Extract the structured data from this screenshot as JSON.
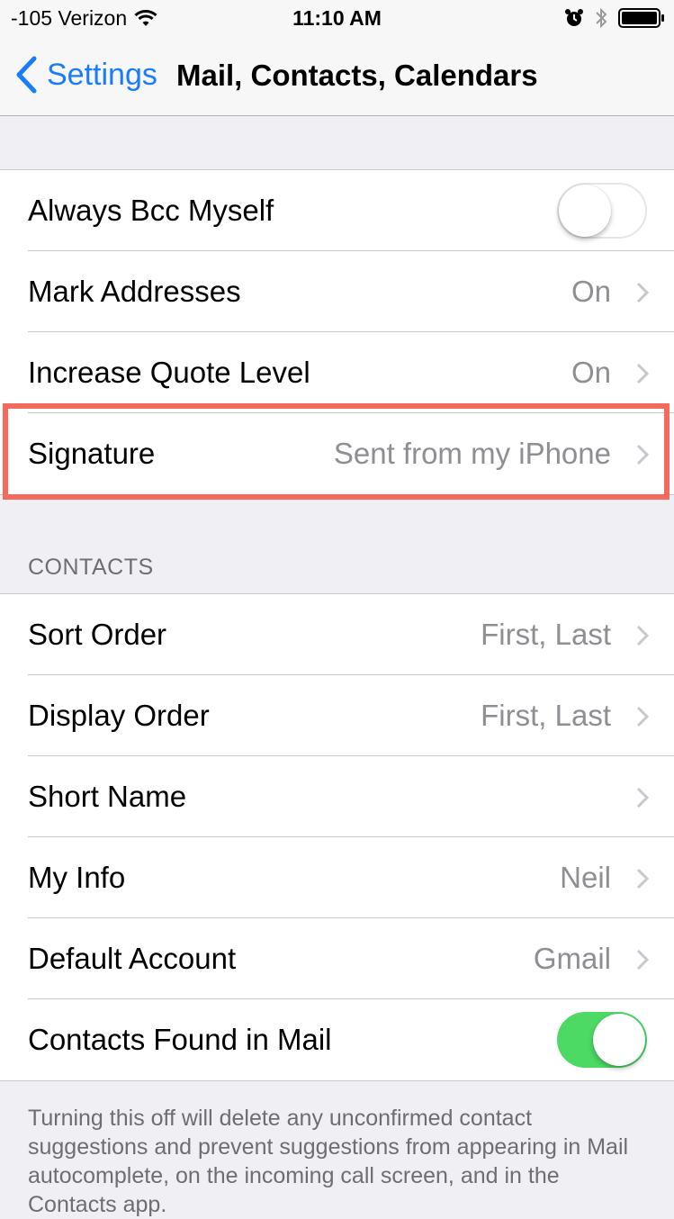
{
  "status_bar": {
    "carrier": "-105 Verizon",
    "time": "11:10 AM"
  },
  "nav": {
    "back_label": "Settings",
    "title": "Mail, Contacts, Calendars"
  },
  "mail_group": [
    {
      "label": "Always Bcc Myself",
      "type": "toggle",
      "on": false
    },
    {
      "label": "Mark Addresses",
      "value": "On",
      "type": "disclosure"
    },
    {
      "label": "Increase Quote Level",
      "value": "On",
      "type": "disclosure"
    },
    {
      "label": "Signature",
      "value": "Sent from my iPhone",
      "type": "disclosure",
      "highlighted": true
    }
  ],
  "contacts_header": "CONTACTS",
  "contacts_group": [
    {
      "label": "Sort Order",
      "value": "First, Last",
      "type": "disclosure"
    },
    {
      "label": "Display Order",
      "value": "First, Last",
      "type": "disclosure"
    },
    {
      "label": "Short Name",
      "value": "",
      "type": "disclosure"
    },
    {
      "label": "My Info",
      "value": "Neil",
      "type": "disclosure"
    },
    {
      "label": "Default Account",
      "value": "Gmail",
      "type": "disclosure"
    },
    {
      "label": "Contacts Found in Mail",
      "type": "toggle",
      "on": true
    }
  ],
  "contacts_footer": "Turning this off will delete any unconfirmed contact suggestions and prevent suggestions from appearing in Mail autocomplete, on the incoming call screen, and in the Contacts app.",
  "colors": {
    "accent": "#1a7cfa",
    "toggle_on": "#4cd964",
    "highlight": "#f56a5c"
  }
}
